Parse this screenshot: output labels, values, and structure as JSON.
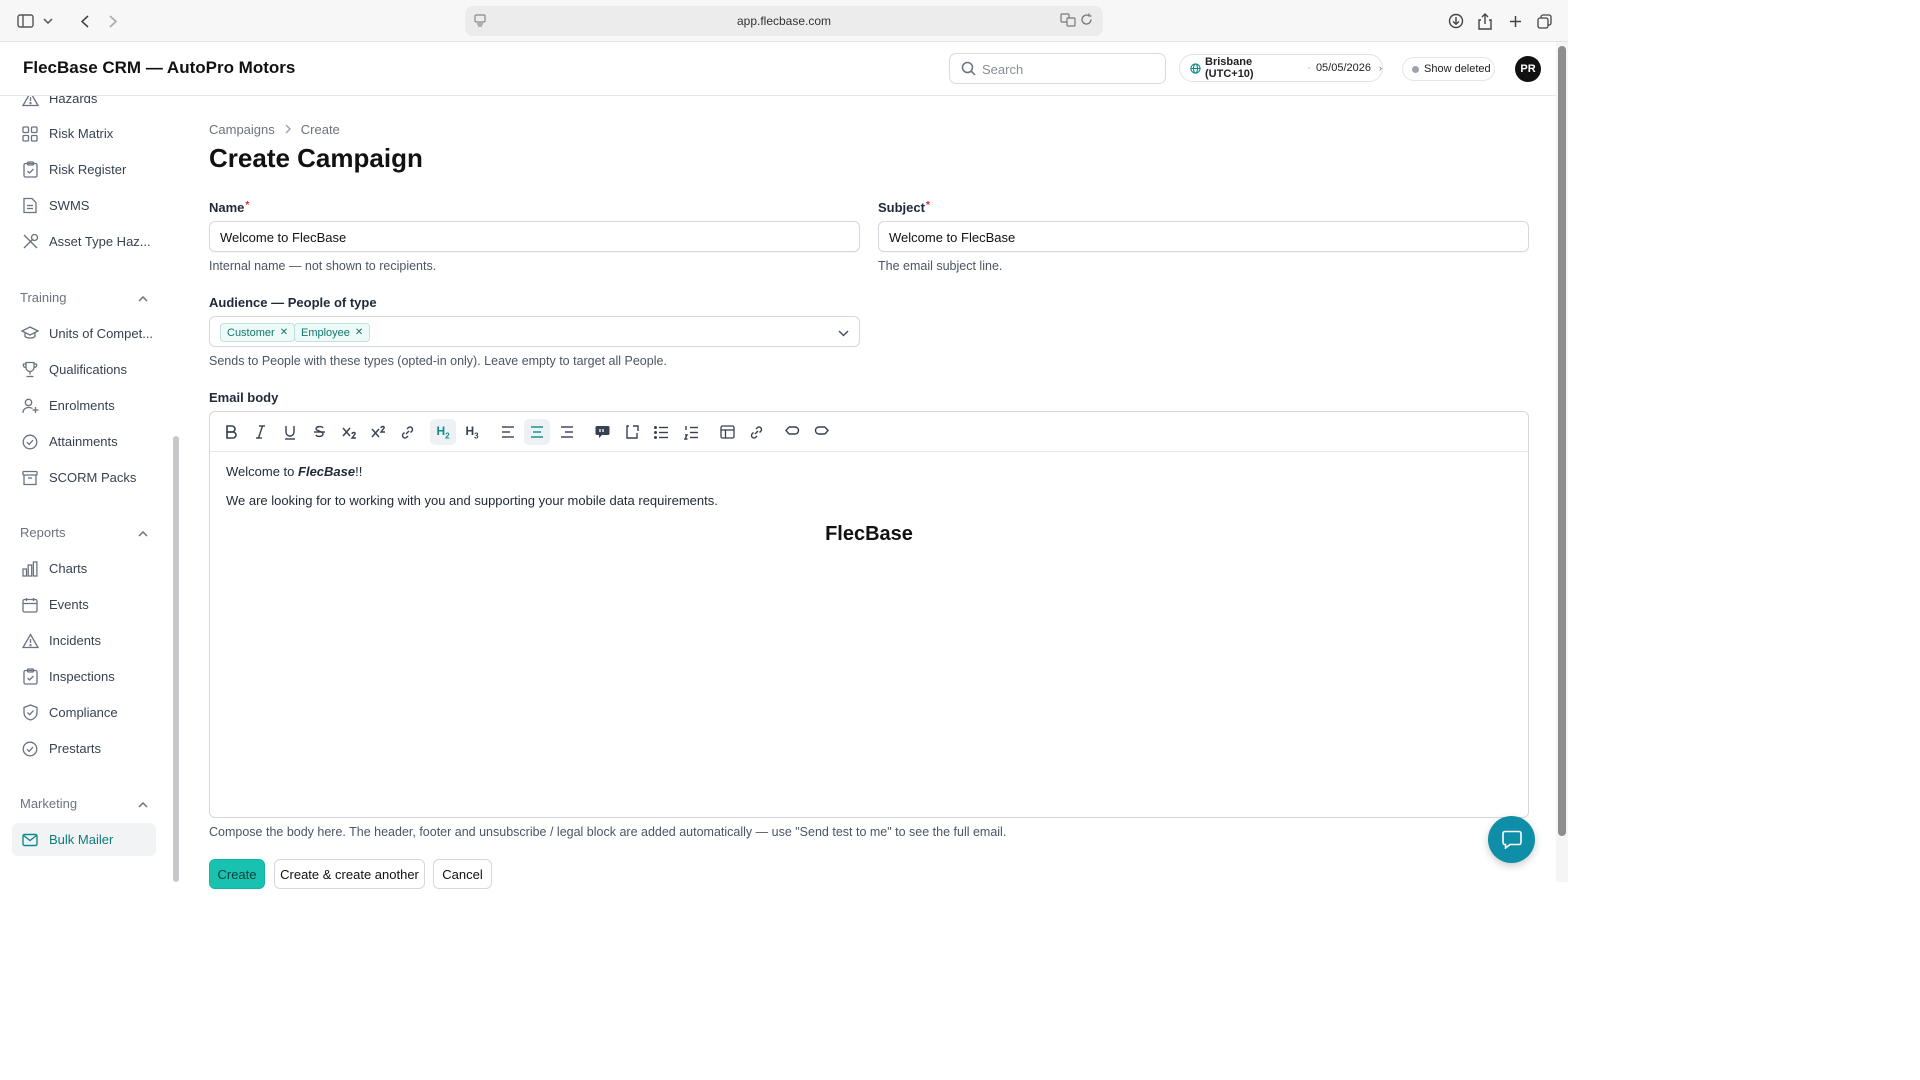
{
  "browser": {
    "url": "app.flecbase.com"
  },
  "header": {
    "title": "FlecBase CRM — AutoPro Motors",
    "search_placeholder": "Search",
    "timezone": "Brisbane (UTC+10)",
    "date": "05/05/2026",
    "show_deleted": "Show deleted",
    "avatar_initials": "PR"
  },
  "sidebar": {
    "top_items": [
      {
        "label": "Hazards",
        "icon": "warning-icon"
      },
      {
        "label": "Risk Matrix",
        "icon": "grid-icon"
      },
      {
        "label": "Risk Register",
        "icon": "clipboard-check-icon"
      },
      {
        "label": "SWMS",
        "icon": "document-icon"
      },
      {
        "label": "Asset Type Haz...",
        "icon": "tools-icon"
      }
    ],
    "training": {
      "title": "Training",
      "items": [
        {
          "label": "Units of Compet...",
          "icon": "graduation-cap-icon"
        },
        {
          "label": "Qualifications",
          "icon": "trophy-icon"
        },
        {
          "label": "Enrolments",
          "icon": "user-plus-icon"
        },
        {
          "label": "Attainments",
          "icon": "check-circle-icon"
        },
        {
          "label": "SCORM Packs",
          "icon": "archive-box-icon"
        }
      ]
    },
    "reports": {
      "title": "Reports",
      "items": [
        {
          "label": "Charts",
          "icon": "bar-chart-icon"
        },
        {
          "label": "Events",
          "icon": "calendar-icon"
        },
        {
          "label": "Incidents",
          "icon": "warning-icon"
        },
        {
          "label": "Inspections",
          "icon": "clipboard-check-icon"
        },
        {
          "label": "Compliance",
          "icon": "shield-check-icon"
        },
        {
          "label": "Prestarts",
          "icon": "check-circle-icon"
        }
      ]
    },
    "marketing": {
      "title": "Marketing",
      "items": [
        {
          "label": "Bulk Mailer",
          "icon": "envelope-icon",
          "active": true
        }
      ]
    }
  },
  "breadcrumb": {
    "parent": "Campaigns",
    "current": "Create"
  },
  "page_title": "Create Campaign",
  "form": {
    "name": {
      "label": "Name",
      "required_mark": "*",
      "value": "Welcome to FlecBase",
      "hint": "Internal name — not shown to recipients."
    },
    "subject": {
      "label": "Subject",
      "required_mark": "*",
      "value": "Welcome to FlecBase",
      "hint": "The email subject line."
    },
    "audience": {
      "label": "Audience — People of type",
      "tags": [
        "Customer",
        "Employee"
      ],
      "hint": "Sends to People with these types (opted-in only). Leave empty to target all People."
    },
    "email_body": {
      "label": "Email body",
      "line1_prefix": "Welcome to ",
      "line1_emph": "FlecBase",
      "line1_suffix": "!!",
      "line2": "We are looking for to working with you and supporting your mobile data requirements.",
      "heading": "FlecBase",
      "hint": "Compose the body here. The header, footer and unsubscribe / legal block are added automatically — use \"Send test to me\" to see the full email."
    }
  },
  "actions": {
    "create": "Create",
    "create_another": "Create & create another",
    "cancel": "Cancel"
  },
  "colors": {
    "accent": "#19c2b0",
    "active_nav": "#0e7a7a",
    "chat_button": "#0f8ea8",
    "required": "#dc2626"
  }
}
